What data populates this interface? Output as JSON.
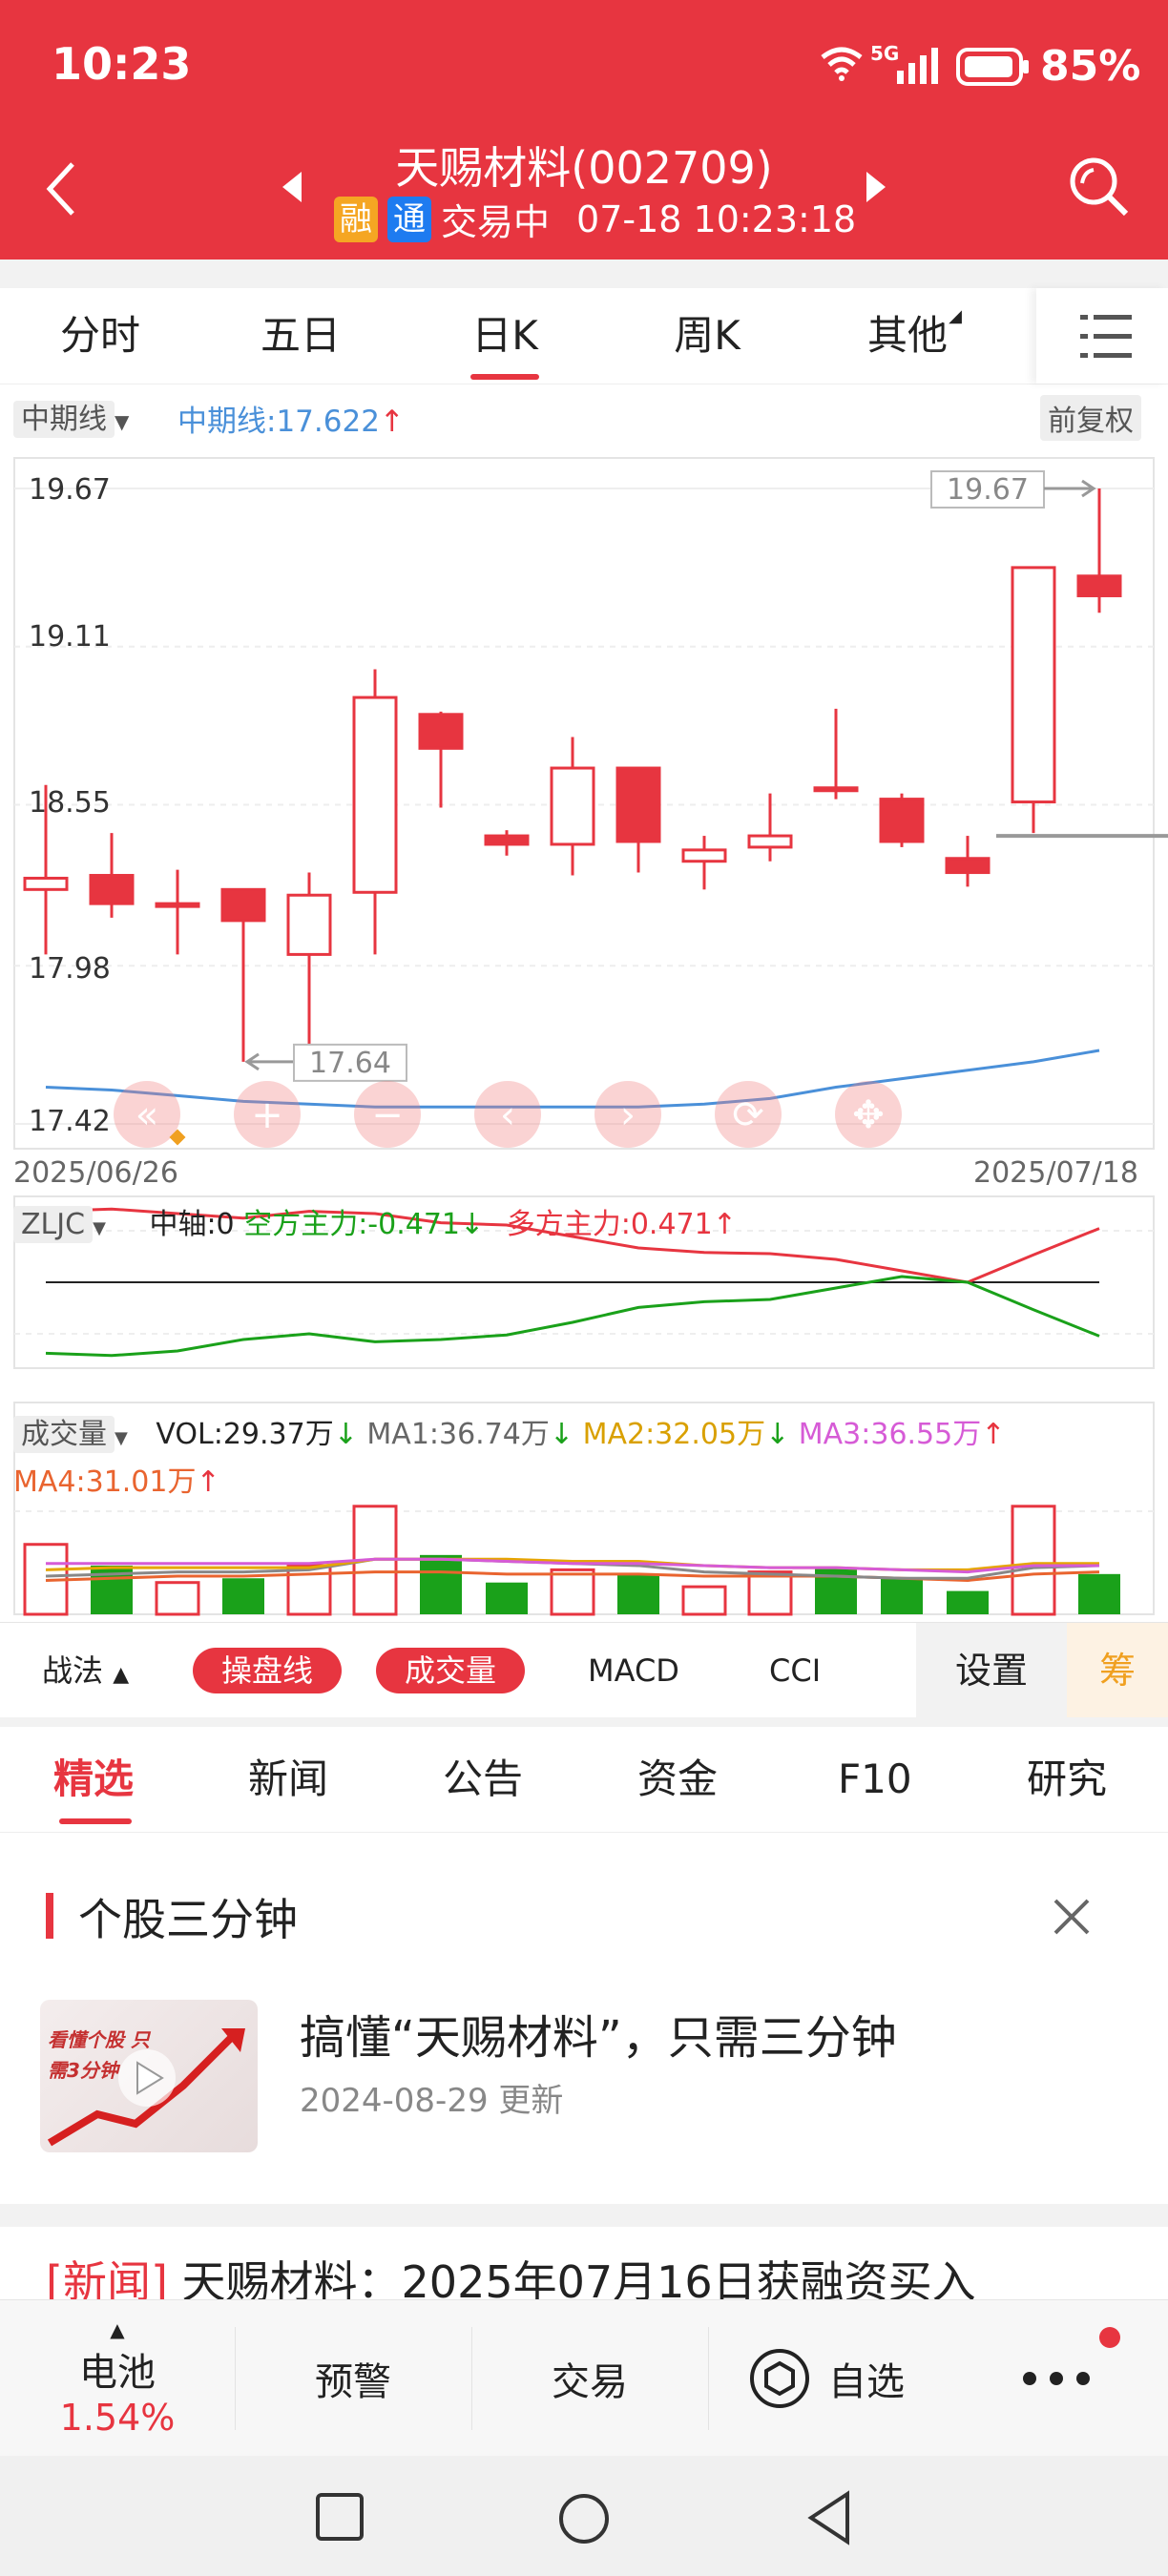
{
  "status_bar": {
    "time": "10:23",
    "network": "5G",
    "battery": "85%"
  },
  "header": {
    "title": "天赐材料(002709)",
    "badge_rong": "融",
    "badge_tong": "通",
    "status": "交易中",
    "datetime": "07-18 10:23:18"
  },
  "period_tabs": [
    {
      "label": "分时",
      "active": false
    },
    {
      "label": "五日",
      "active": false
    },
    {
      "label": "日K",
      "active": true
    },
    {
      "label": "周K",
      "active": false
    },
    {
      "label": "其他",
      "active": false
    }
  ],
  "chart_header": {
    "indicator_select": "中期线",
    "indicator_value": "中期线:17.622",
    "adjust": "前复权"
  },
  "chart_data": {
    "type": "candlestick",
    "y_ticks": [
      "19.67",
      "19.11",
      "18.55",
      "17.98",
      "17.42"
    ],
    "ylim": [
      17.42,
      19.67
    ],
    "dates": {
      "start": "2025/06/26",
      "end": "2025/07/18"
    },
    "max_label": "19.67",
    "min_label": "17.64",
    "candles": [
      {
        "o": 18.25,
        "c": 18.29,
        "h": 18.62,
        "l": 18.02
      },
      {
        "o": 18.3,
        "c": 18.2,
        "h": 18.45,
        "l": 18.15
      },
      {
        "o": 18.2,
        "c": 18.2,
        "h": 18.32,
        "l": 18.02
      },
      {
        "o": 18.25,
        "c": 18.14,
        "h": 18.25,
        "l": 17.64
      },
      {
        "o": 18.02,
        "c": 18.23,
        "h": 18.31,
        "l": 17.7
      },
      {
        "o": 18.24,
        "c": 18.93,
        "h": 19.03,
        "l": 18.02
      },
      {
        "o": 18.87,
        "c": 18.75,
        "h": 18.88,
        "l": 18.54
      },
      {
        "o": 18.44,
        "c": 18.41,
        "h": 18.46,
        "l": 18.37
      },
      {
        "o": 18.41,
        "c": 18.68,
        "h": 18.79,
        "l": 18.3
      },
      {
        "o": 18.68,
        "c": 18.42,
        "h": 18.68,
        "l": 18.31
      },
      {
        "o": 18.35,
        "c": 18.39,
        "h": 18.44,
        "l": 18.25
      },
      {
        "o": 18.4,
        "c": 18.44,
        "h": 18.59,
        "l": 18.35
      },
      {
        "o": 18.61,
        "c": 18.6,
        "h": 18.89,
        "l": 18.57
      },
      {
        "o": 18.57,
        "c": 18.42,
        "h": 18.59,
        "l": 18.4
      },
      {
        "o": 18.36,
        "c": 18.31,
        "h": 18.44,
        "l": 18.26
      },
      {
        "o": 18.56,
        "c": 19.39,
        "h": 19.39,
        "l": 18.45
      },
      {
        "o": 19.36,
        "c": 19.29,
        "h": 19.67,
        "l": 19.23
      }
    ],
    "ma_line": [
      17.55,
      17.54,
      17.52,
      17.5,
      17.49,
      17.48,
      17.48,
      17.48,
      17.48,
      17.48,
      17.49,
      17.51,
      17.55,
      17.58,
      17.61,
      17.64,
      17.68
    ],
    "last_price_line": 18.44,
    "zljc": {
      "label": "ZLJC",
      "axis_text": "中轴:0",
      "kong_text": "空方主力:-0.471",
      "duo_text": "多方主力:0.471",
      "duo": [
        0.62,
        0.64,
        0.6,
        0.56,
        0.62,
        0.6,
        0.52,
        0.5,
        0.4,
        0.3,
        0.26,
        0.25,
        0.2,
        0.1,
        0.0,
        0.24,
        0.47
      ],
      "kong": [
        -0.62,
        -0.64,
        -0.6,
        -0.5,
        -0.45,
        -0.52,
        -0.5,
        -0.46,
        -0.35,
        -0.22,
        -0.17,
        -0.15,
        -0.05,
        0.05,
        0.0,
        -0.24,
        -0.47
      ]
    },
    "volume": {
      "label": "成交量",
      "vol_text": "VOL:29.37万",
      "ma1_text": "MA1:36.74万",
      "ma2_text": "MA2:32.05万",
      "ma3_text": "MA3:36.55万",
      "ma4_text": "MA4:31.01万",
      "bars": [
        {
          "v": 33,
          "up": true
        },
        {
          "v": 23,
          "up": false
        },
        {
          "v": 15,
          "up": true
        },
        {
          "v": 17,
          "up": false
        },
        {
          "v": 23,
          "up": true
        },
        {
          "v": 51,
          "up": true
        },
        {
          "v": 28,
          "up": false
        },
        {
          "v": 15,
          "up": false
        },
        {
          "v": 21,
          "up": true
        },
        {
          "v": 19,
          "up": false
        },
        {
          "v": 13,
          "up": true
        },
        {
          "v": 20,
          "up": true
        },
        {
          "v": 22,
          "up": false
        },
        {
          "v": 17,
          "up": false
        },
        {
          "v": 11,
          "up": false
        },
        {
          "v": 51,
          "up": true
        },
        {
          "v": 19,
          "up": false
        }
      ],
      "ma1": [
        18,
        19,
        20,
        20,
        21,
        26,
        26,
        25,
        24,
        23,
        20,
        19,
        18,
        17,
        17,
        22,
        23
      ],
      "ma2": [
        21,
        22,
        22,
        22,
        22,
        26,
        26,
        26,
        25,
        25,
        23,
        22,
        22,
        21,
        21,
        24,
        24
      ],
      "ma3": [
        24,
        24,
        24,
        24,
        24,
        26,
        26,
        25,
        24,
        24,
        23,
        22,
        22,
        21,
        20,
        23,
        23
      ],
      "ma4": [
        16,
        17,
        18,
        18,
        19,
        20,
        20,
        19,
        19,
        19,
        18,
        18,
        18,
        17,
        16,
        19,
        20
      ]
    }
  },
  "indicator_bar": {
    "strategy": "战法",
    "items": [
      "操盘线",
      "成交量",
      "MACD",
      "CCI"
    ],
    "settings": "设置",
    "chip": "筹"
  },
  "news_tabs": [
    "精选",
    "新闻",
    "公告",
    "资金",
    "F10",
    "研究"
  ],
  "card": {
    "title": "个股三分钟",
    "thumb_text": "看懂个股 只需3分钟",
    "headline": "搞懂“天赐材料”，只需三分钟",
    "date_text": "2024-08-29 更新"
  },
  "news_item": {
    "tag": "[新闻]",
    "text": "天赐材料：2025年07月16日获融资买入"
  },
  "bottom_nav": {
    "sector": "电池",
    "sector_change": "1.54%",
    "alert": "预警",
    "trade": "交易",
    "watch": "自选"
  },
  "colors": {
    "brand": "#e73540",
    "up": "#e73540",
    "down": "#1aa11a",
    "ma_blue": "#4a90d9"
  }
}
